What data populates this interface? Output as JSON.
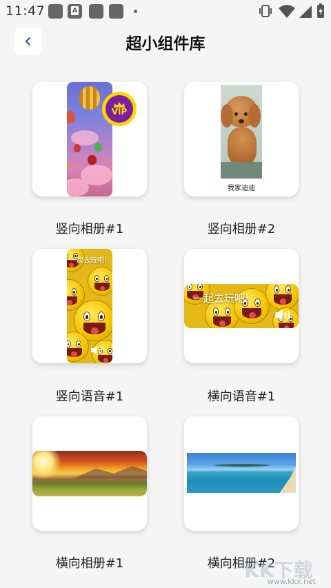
{
  "status_bar": {
    "time": "11:47",
    "notification_icons": [
      "app-icon",
      "a-icon",
      "app-icon",
      "app-icon"
    ],
    "system_icons": [
      "vibrate-icon",
      "wifi-icon",
      "signal-icon",
      "battery-charging-icon"
    ]
  },
  "header": {
    "back_icon": "chevron-left-icon",
    "title": "超小组件库"
  },
  "widgets": [
    {
      "label": "竖向相册#1",
      "kind": "vertical-album",
      "vip": true,
      "vip_badge_text": "VIP"
    },
    {
      "label": "竖向相册#2",
      "kind": "vertical-album",
      "caption": "我家迪迪"
    },
    {
      "label": "竖向语音#1",
      "kind": "vertical-voice",
      "overlay_text": "一起去玩吧!"
    },
    {
      "label": "横向语音#1",
      "kind": "horizontal-voice",
      "overlay_text": "一起去玩吧!"
    },
    {
      "label": "横向相册#1",
      "kind": "horizontal-album"
    },
    {
      "label": "横向相册#2",
      "kind": "horizontal-album"
    }
  ],
  "watermark": {
    "logo_text": "KK下载",
    "url": "www.kkx.net"
  },
  "colors": {
    "background": "#f5f5f5",
    "card": "#ffffff",
    "vip_gold": "#ffd600",
    "vip_purple": "#7b1fa2"
  }
}
